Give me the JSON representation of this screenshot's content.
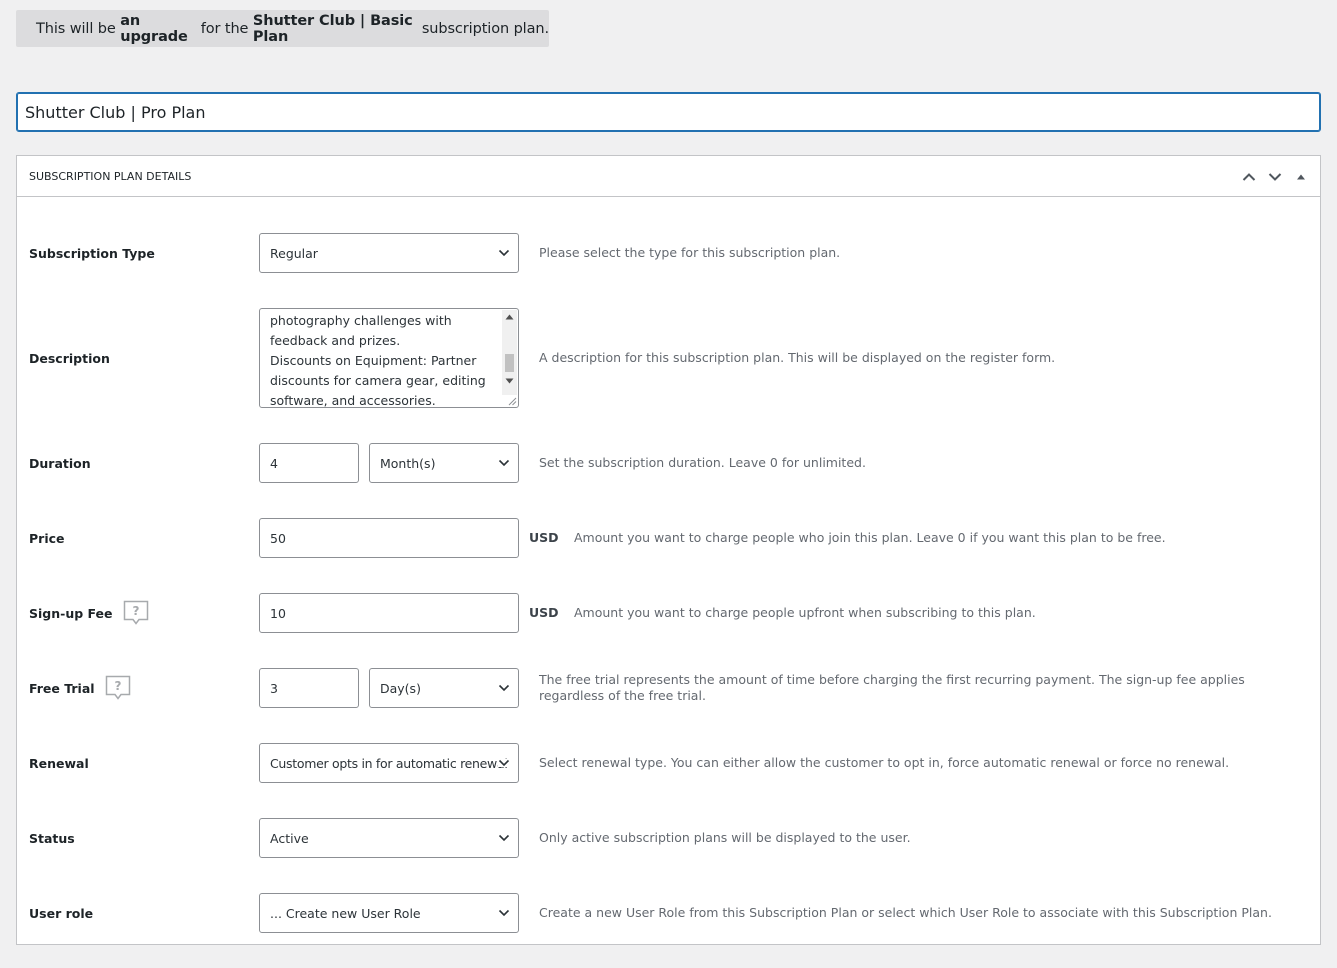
{
  "notice": {
    "part1": "This will be ",
    "part2": "an upgrade",
    "part3": " for the ",
    "part4": "Shutter Club | Basic Plan",
    "part5": " subscription plan."
  },
  "title_value": "Shutter Club | Pro Plan",
  "metabox": {
    "title": "SUBSCRIPTION PLAN DETAILS",
    "move_up_icon": "chevron-up-icon",
    "move_down_icon": "chevron-down-icon",
    "toggle_icon": "triangle-up-icon"
  },
  "fields": {
    "subscription_type": {
      "label": "Subscription Type",
      "value": "Regular",
      "desc": "Please select the type for this subscription plan."
    },
    "description": {
      "label": "Description",
      "lines": [
        "photography challenges with",
        "feedback and prizes.",
        "Discounts on Equipment: Partner",
        "discounts for camera gear, editing",
        "software, and accessories."
      ],
      "desc": "A description for this subscription plan. This will be displayed on the register form."
    },
    "duration": {
      "label": "Duration",
      "value": "4",
      "unit": "Month(s)",
      "desc": "Set the subscription duration. Leave 0 for unlimited."
    },
    "price": {
      "label": "Price",
      "value": "50",
      "currency": "USD",
      "desc": "Amount you want to charge people who join this plan. Leave 0 if you want this plan to be free."
    },
    "signup_fee": {
      "label": "Sign-up Fee",
      "value": "10",
      "currency": "USD",
      "desc": "Amount you want to charge people upfront when subscribing to this plan."
    },
    "free_trial": {
      "label": "Free Trial",
      "value": "3",
      "unit": "Day(s)",
      "desc": "The free trial represents the amount of time before charging the first recurring payment. The sign-up fee applies regardless of the free trial."
    },
    "renewal": {
      "label": "Renewal",
      "value": "Customer opts in for automatic renewal",
      "desc": "Select renewal type. You can either allow the customer to opt in, force automatic renewal or force no renewal."
    },
    "status": {
      "label": "Status",
      "value": "Active",
      "desc": "Only active subscription plans will be displayed to the user."
    },
    "user_role": {
      "label": "User role",
      "value": "... Create new User Role",
      "desc": "Create a new User Role from this Subscription Plan or select which User Role to associate with this Subscription Plan."
    }
  }
}
